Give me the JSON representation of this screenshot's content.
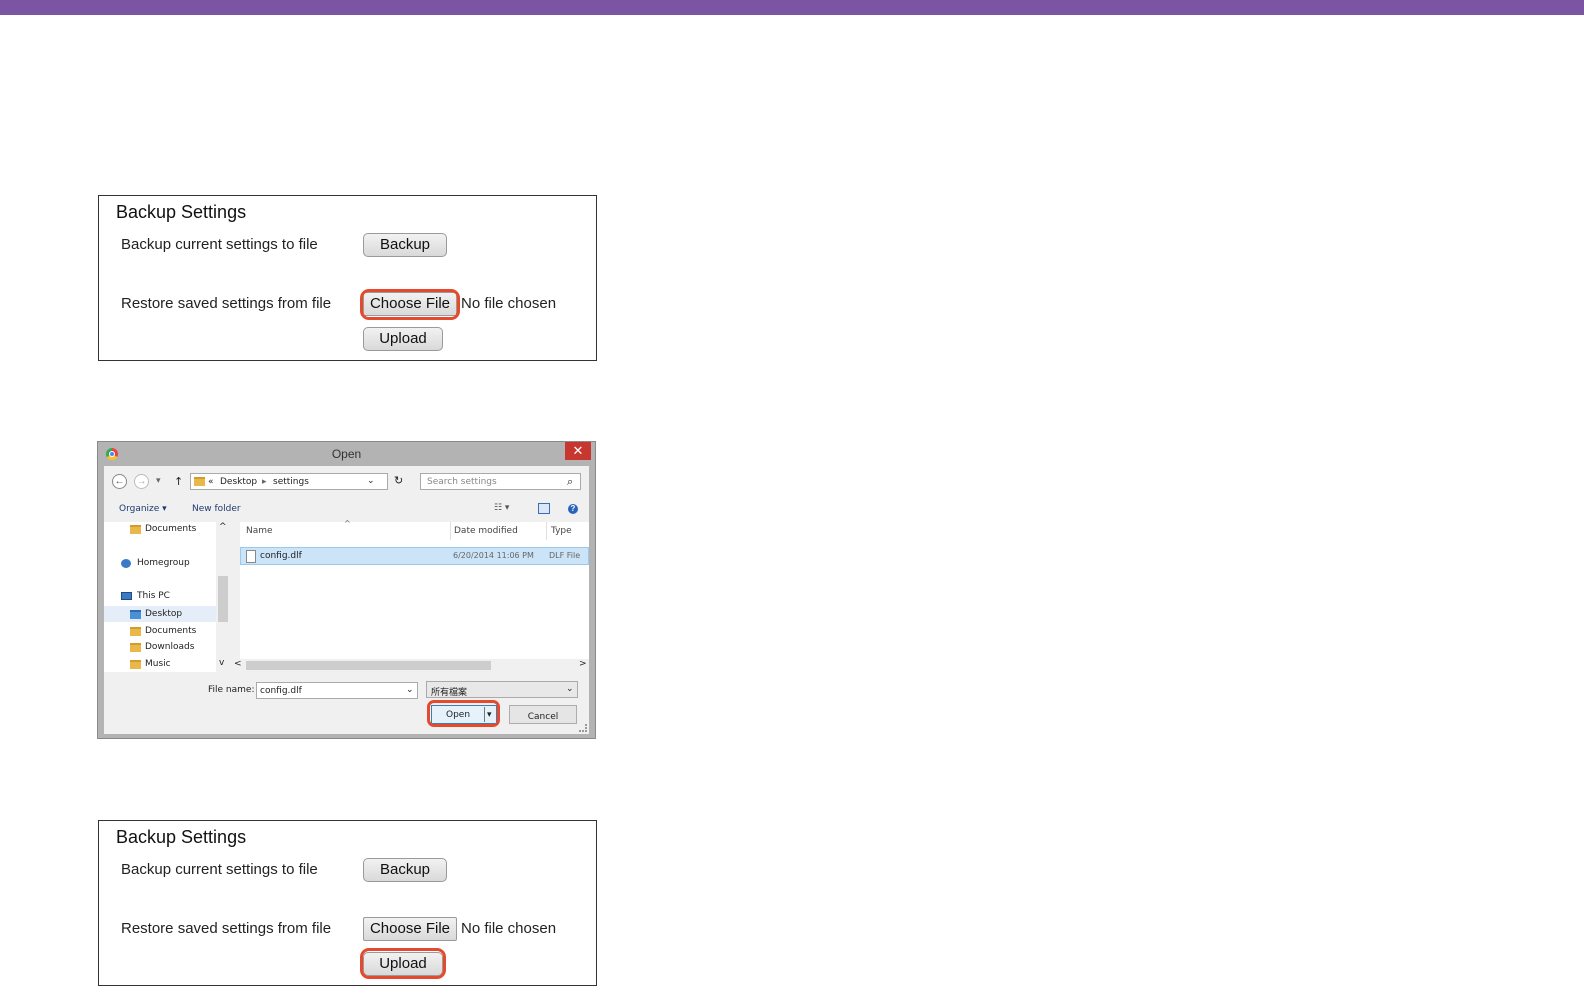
{
  "panel": {
    "title": "Backup Settings",
    "backup_label": "Backup current settings to file",
    "backup_button": "Backup",
    "restore_label": "Restore saved settings from file",
    "choose_file_button": "Choose File",
    "no_file_text": "No file chosen",
    "upload_button": "Upload"
  },
  "dialog": {
    "title": "Open",
    "close_glyph": "✕",
    "back_glyph": "←",
    "forward_glyph": "→",
    "recent_glyph": "▾",
    "up_glyph": "↑",
    "path_prefix": "«",
    "path": [
      "Desktop",
      "settings"
    ],
    "path_sep": "▸",
    "refresh_glyph": "↻",
    "dropdown_glyph": "⌄",
    "search_placeholder": "Search settings",
    "search_glyph": "⌕",
    "toolbar": {
      "organize": "Organize ▾",
      "new_folder": "New folder",
      "views_glyph": "☷ ▾",
      "help_glyph": "?"
    },
    "nav": {
      "documents_top": "Documents",
      "homegroup": "Homegroup",
      "this_pc": "This PC",
      "desktop": "Desktop",
      "documents": "Documents",
      "downloads": "Downloads",
      "music": "Music"
    },
    "scroll_up": "^",
    "scroll_down": "v",
    "scroll_left": "<",
    "scroll_right": ">",
    "sort_glyph": "^",
    "columns": {
      "name": "Name",
      "date": "Date modified",
      "type": "Type"
    },
    "files": [
      {
        "name": "config.dlf",
        "date": "6/20/2014 11:06 PM",
        "type": "DLF File"
      }
    ],
    "file_name_label": "File name:",
    "file_name_value": "config.dlf",
    "filter_value": "所有檔案",
    "open_button": "Open",
    "open_arrow": "▾",
    "cancel_button": "Cancel"
  },
  "colors": {
    "header_bar": "#7b54a3",
    "highlight": "#e64a2e",
    "selection": "#cce4f7",
    "close_button": "#c7372f"
  }
}
